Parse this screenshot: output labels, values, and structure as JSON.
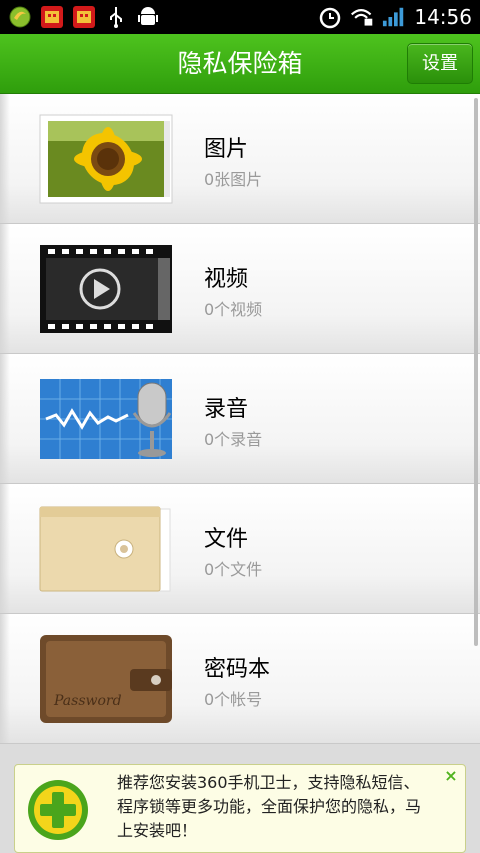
{
  "status_bar": {
    "time": "14:56",
    "icons": [
      "browser-ball-icon",
      "app-badge-icon",
      "app-badge-icon",
      "usb-icon",
      "android-icon",
      "alarm-icon",
      "wifi-lock-icon",
      "signal-icon"
    ]
  },
  "header": {
    "title": "隐私保险箱",
    "settings_label": "设置"
  },
  "items": [
    {
      "title": "图片",
      "subtitle": "0张图片",
      "icon": "photo-sunflower-icon"
    },
    {
      "title": "视频",
      "subtitle": "0个视频",
      "icon": "video-film-icon"
    },
    {
      "title": "录音",
      "subtitle": "0个录音",
      "icon": "microphone-waveform-icon"
    },
    {
      "title": "文件",
      "subtitle": "0个文件",
      "icon": "envelope-folder-icon"
    },
    {
      "title": "密码本",
      "subtitle": "0个帐号",
      "icon": "password-wallet-icon"
    }
  ],
  "promo": {
    "text": "推荐您安装360手机卫士，支持隐私短信、程序锁等更多功能，全面保护您的隐私，马上安装吧！",
    "close_label": "×",
    "icon": "360-plus-icon"
  },
  "colors": {
    "header_green": "#3cb014",
    "subtitle_gray": "#9a9a9a",
    "promo_bg": "#fdfde5"
  }
}
